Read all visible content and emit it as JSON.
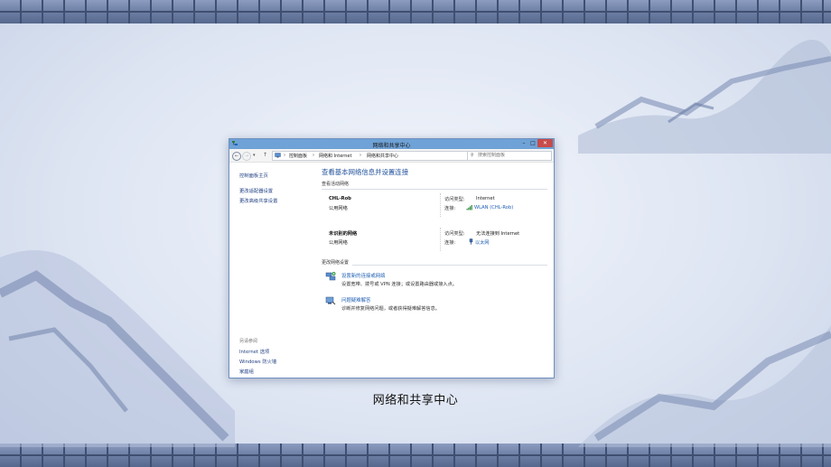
{
  "window": {
    "title": "网络和共享中心",
    "controls": {
      "minimize": "–",
      "maximize": "□",
      "close": "✕"
    }
  },
  "address_bar": {
    "breadcrumbs": [
      "控制面板",
      "网络和 Internet",
      "网络和共享中心"
    ],
    "separator": "›",
    "search_placeholder": "搜索控制面板"
  },
  "sidebar": {
    "home_link": "控制面板主页",
    "links": [
      "更改适配器设置",
      "更改高级共享设置"
    ],
    "see_also_label": "另请参阅",
    "see_also_links": [
      "Internet 选项",
      "Windows 防火墙",
      "家庭组"
    ]
  },
  "main": {
    "title": "查看基本网络信息并设置连接",
    "active_networks_label": "查看活动网络",
    "networks": [
      {
        "name": "CHL-Rob",
        "category": "公用网络",
        "access_type_label": "访问类型:",
        "access_type": "Internet",
        "connection_label": "连接:",
        "connection": "WLAN (CHL-Rob)",
        "connection_icon": "wifi-signal-icon"
      },
      {
        "name": "未识别的网络",
        "category": "公用网络",
        "access_type_label": "访问类型:",
        "access_type": "无法连接到 Internet",
        "connection_label": "连接:",
        "connection": "以太网",
        "connection_icon": "ethernet-icon"
      }
    ],
    "change_settings_label": "更改网络设置",
    "tasks": [
      {
        "link": "设置新的连接或网络",
        "description": "设置宽带、拨号或 VPN 连接；或设置路由器或接入点。",
        "icon": "new-connection-icon"
      },
      {
        "link": "问题疑难解答",
        "description": "诊断并修复网络问题，或者获得疑难解答信息。",
        "icon": "troubleshoot-icon"
      }
    ]
  },
  "slide_caption": "网络和共享中心",
  "colors": {
    "titlebar": "#6fa2d6",
    "close_button": "#c74b4b",
    "link": "#1f5fb3",
    "page_title": "#1e4f9a",
    "brick": "#6d7fa4",
    "background": "#dfe6f3"
  }
}
